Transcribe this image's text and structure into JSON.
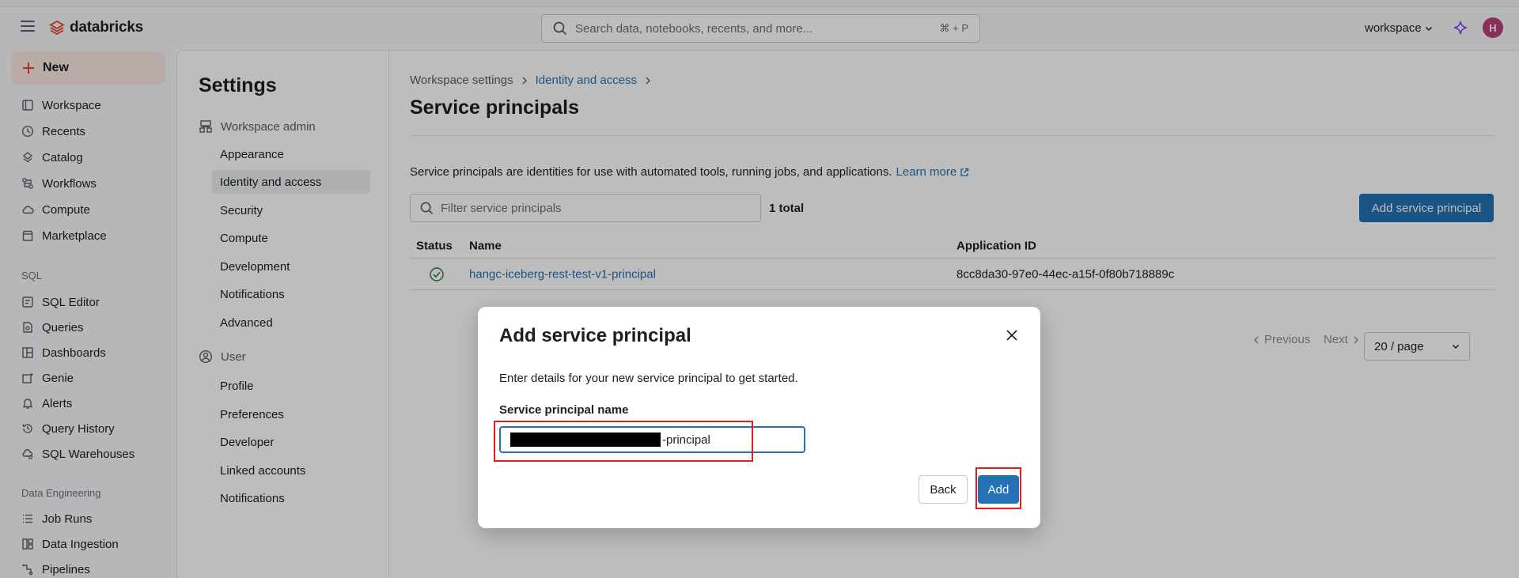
{
  "topbar": {
    "brand": "databricks",
    "search_placeholder": "Search data, notebooks, recents, and more...",
    "search_shortcut": "⌘ + P",
    "workspace_label": "workspace",
    "avatar_initial": "H"
  },
  "sidebar": {
    "new_label": "New",
    "items": [
      {
        "label": "Workspace"
      },
      {
        "label": "Recents"
      },
      {
        "label": "Catalog"
      },
      {
        "label": "Workflows"
      },
      {
        "label": "Compute"
      },
      {
        "label": "Marketplace"
      }
    ],
    "sql_section": "SQL",
    "sql_items": [
      {
        "label": "SQL Editor"
      },
      {
        "label": "Queries"
      },
      {
        "label": "Dashboards"
      },
      {
        "label": "Genie"
      },
      {
        "label": "Alerts"
      },
      {
        "label": "Query History"
      },
      {
        "label": "SQL Warehouses"
      }
    ],
    "de_section": "Data Engineering",
    "de_items": [
      {
        "label": "Job Runs"
      },
      {
        "label": "Data Ingestion"
      },
      {
        "label": "Pipelines"
      }
    ]
  },
  "settings": {
    "title": "Settings",
    "workspace_admin": "Workspace admin",
    "admin_items": [
      "Appearance",
      "Identity and access",
      "Security",
      "Compute",
      "Development",
      "Notifications",
      "Advanced"
    ],
    "user_group": "User",
    "user_items": [
      "Profile",
      "Preferences",
      "Developer",
      "Linked accounts",
      "Notifications"
    ]
  },
  "main": {
    "breadcrumb_root": "Workspace settings",
    "breadcrumb_link": "Identity and access",
    "title": "Service principals",
    "description": "Service principals are identities for use with automated tools, running jobs, and applications.",
    "learn_more": "Learn more",
    "filter_placeholder": "Filter service principals",
    "total": "1 total",
    "add_button": "Add service principal",
    "columns": {
      "status": "Status",
      "name": "Name",
      "app_id": "Application ID"
    },
    "rows": [
      {
        "name": "hangc-iceberg-rest-test-v1-principal",
        "app_id": "8cc8da30-97e0-44ec-a15f-0f80b718889c"
      }
    ],
    "previous": "Previous",
    "next": "Next",
    "page_size": "20 / page"
  },
  "modal": {
    "title": "Add service principal",
    "description": "Enter details for your new service principal to get started.",
    "field_label": "Service principal name",
    "field_value_visible_suffix": "-principal",
    "back_label": "Back",
    "add_label": "Add"
  },
  "colors": {
    "accent": "#2272b4",
    "annotation": "#e02020",
    "new_button_bg": "#fbe6e3",
    "avatar": "#b9407a"
  }
}
